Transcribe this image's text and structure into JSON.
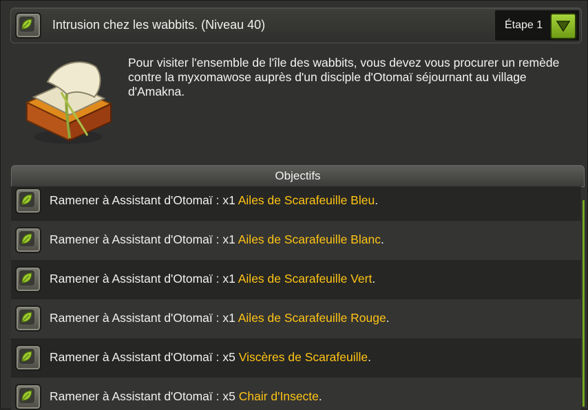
{
  "quest": {
    "title": "Intrusion chez les wabbits. (Niveau 40)",
    "stage_label": "Étape 1",
    "description": "Pour visiter l'ensemble de l'île des wabbits, vous devez vous procurer un remède contre la myxomawose auprès d'un disciple d'Otomaï séjournant au village d'Amakna."
  },
  "objectives": {
    "header": "Objectifs",
    "items": [
      {
        "prefix": "Ramener à Assistant d'Otomaï : x1 ",
        "item": "Ailes de Scarafeuille Bleu",
        "suffix": "."
      },
      {
        "prefix": "Ramener à Assistant d'Otomaï : x1 ",
        "item": "Ailes de Scarafeuille Blanc",
        "suffix": "."
      },
      {
        "prefix": "Ramener à Assistant d'Otomaï : x1 ",
        "item": "Ailes de Scarafeuille Vert",
        "suffix": "."
      },
      {
        "prefix": "Ramener à Assistant d'Otomaï : x1 ",
        "item": "Ailes de Scarafeuille Rouge",
        "suffix": "."
      },
      {
        "prefix": "Ramener à Assistant d'Otomaï : x5 ",
        "item": "Viscères de Scarafeuille",
        "suffix": "."
      },
      {
        "prefix": "Ramener à Assistant d'Otomaï : x5 ",
        "item": "Chair d'Insecte",
        "suffix": "."
      }
    ]
  },
  "icons": {
    "quest_icon": "leaf-icon",
    "stage_toggle": "triangle-down-icon",
    "book": "quest-book-icon"
  },
  "colors": {
    "item_highlight": "#ffc414",
    "accent_green": "#8cbf24"
  }
}
